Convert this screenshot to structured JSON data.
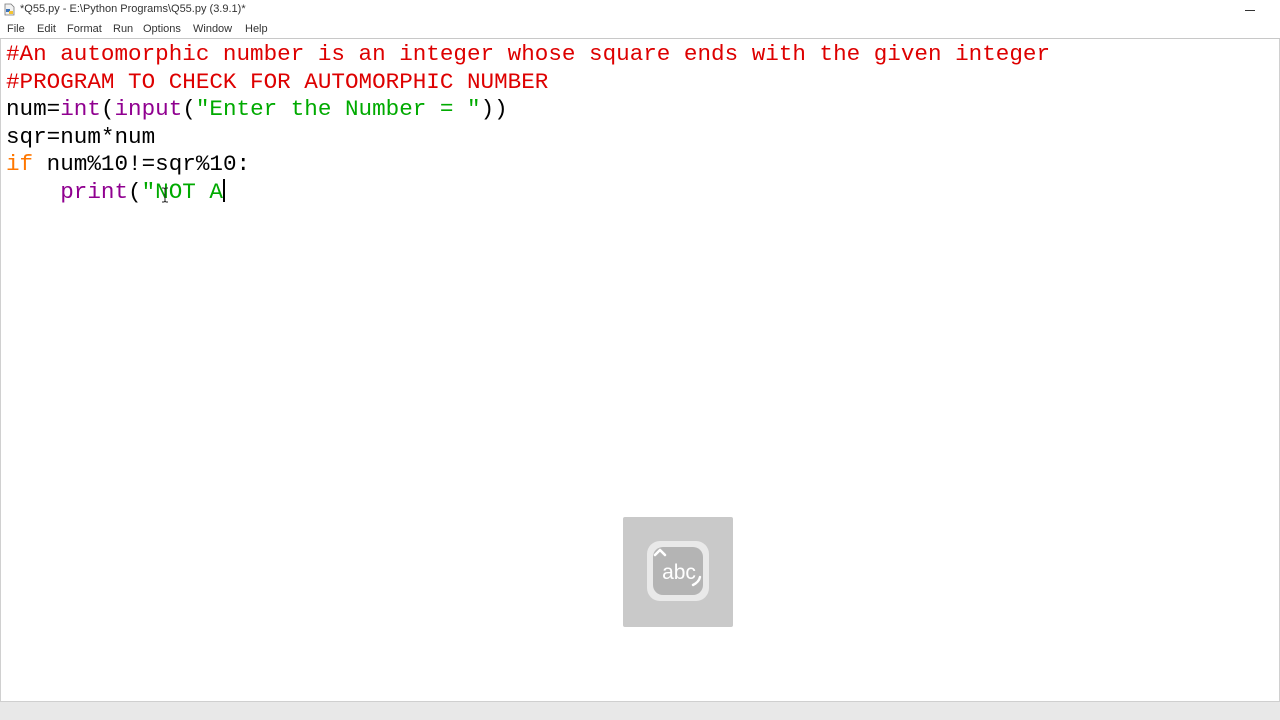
{
  "window": {
    "title": "*Q55.py - E:\\Python Programs\\Q55.py (3.9.1)*"
  },
  "menu": {
    "items": [
      {
        "label": "File"
      },
      {
        "label": "Edit"
      },
      {
        "label": "Format"
      },
      {
        "label": "Run"
      },
      {
        "label": "Options"
      },
      {
        "label": "Window"
      },
      {
        "label": "Help"
      }
    ]
  },
  "editor": {
    "lines": [
      [
        {
          "t": "#An automorphic number is an integer whose square ends with the given integer",
          "c": "comment"
        }
      ],
      [
        {
          "t": "#PROGRAM TO CHECK FOR AUTOMORPHIC NUMBER",
          "c": "comment"
        }
      ],
      [
        {
          "t": "num=",
          "c": "plain"
        },
        {
          "t": "int",
          "c": "builtin"
        },
        {
          "t": "(",
          "c": "plain"
        },
        {
          "t": "input",
          "c": "builtin"
        },
        {
          "t": "(",
          "c": "plain"
        },
        {
          "t": "\"Enter the Number = \"",
          "c": "string"
        },
        {
          "t": "))",
          "c": "plain"
        }
      ],
      [
        {
          "t": "sqr=num*num",
          "c": "plain"
        }
      ],
      [
        {
          "t": "if",
          "c": "keyword"
        },
        {
          "t": " num%10!=sqr%10:",
          "c": "plain"
        }
      ],
      [
        {
          "t": "    ",
          "c": "plain"
        },
        {
          "t": "print",
          "c": "builtin"
        },
        {
          "t": "(",
          "c": "plain"
        },
        {
          "t": "\"NOT A",
          "c": "string"
        }
      ]
    ]
  },
  "overlay": {
    "label": "abc",
    "icon": "touch-keyboard-icon"
  },
  "colors": {
    "comment": "#dd0000",
    "builtin": "#900090",
    "string": "#00aa00",
    "keyword": "#ff7700",
    "plain": "#000000"
  }
}
